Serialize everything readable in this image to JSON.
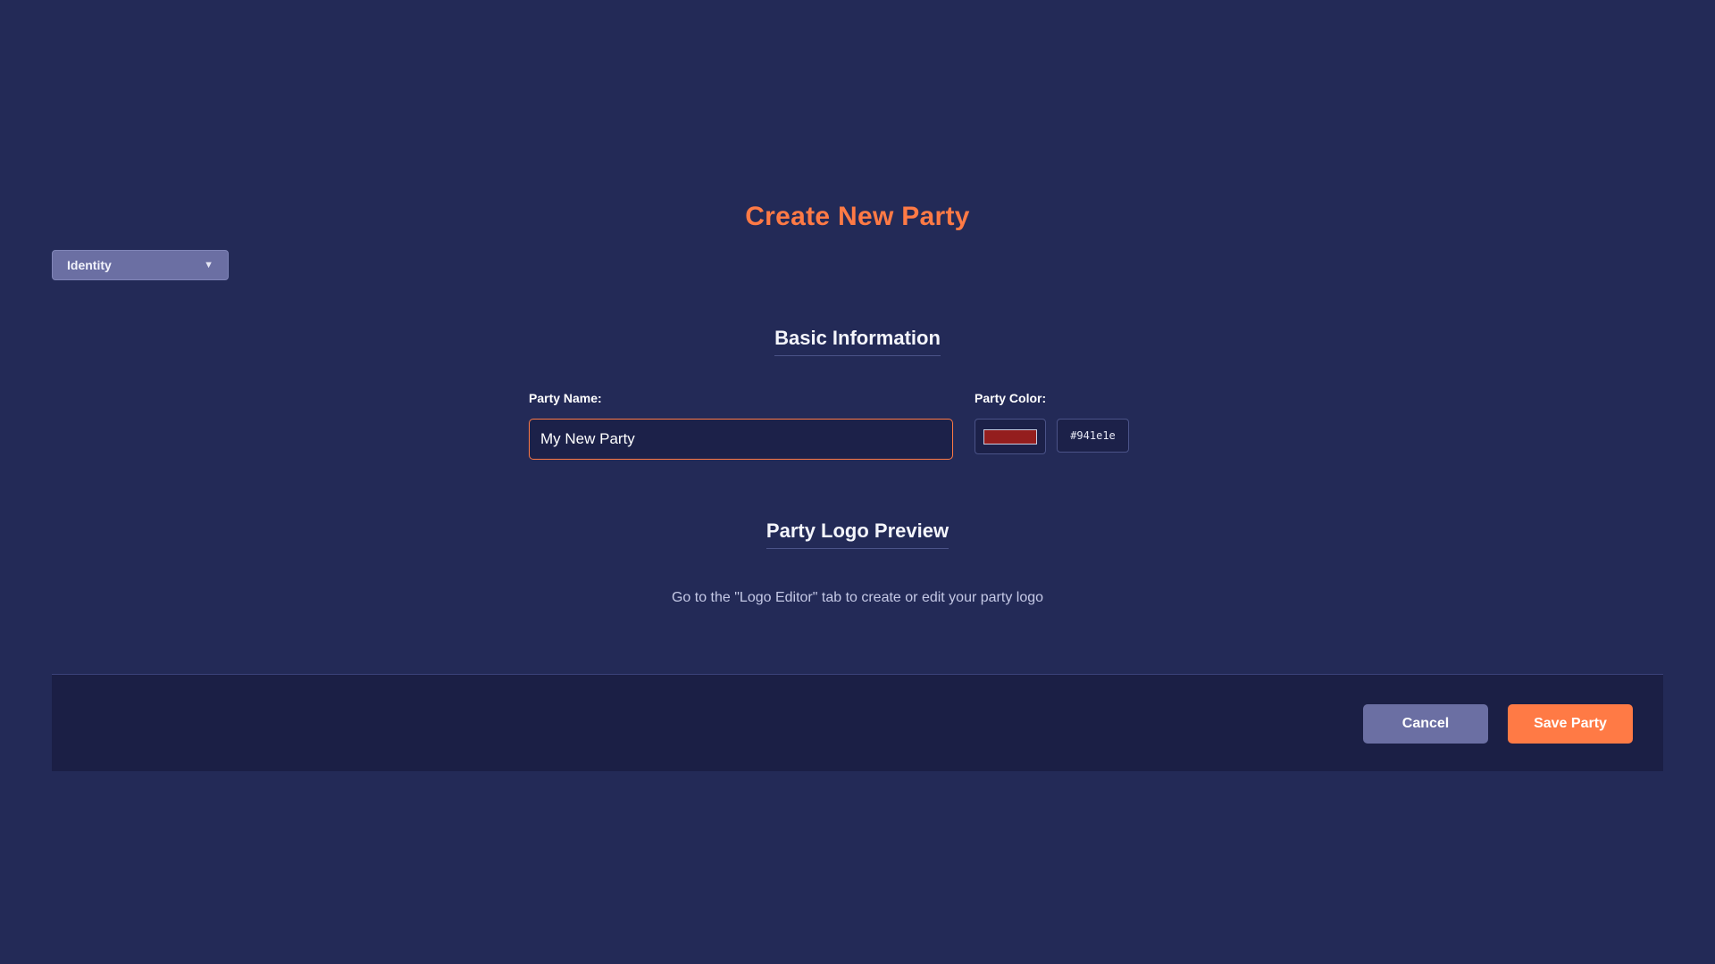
{
  "tab_select": {
    "selected": "Identity",
    "caret_icon": "chevron-down-icon"
  },
  "title": "Create New Party",
  "basic_info": {
    "heading": "Basic Information",
    "party_name_label": "Party Name:",
    "party_name_value": "My New Party",
    "party_color_label": "Party Color:",
    "party_color_value": "#941e1e",
    "party_color_hex_text": "#941e1e"
  },
  "logo_preview": {
    "heading": "Party Logo Preview",
    "hint": "Go to the \"Logo Editor\" tab to create or edit your party logo"
  },
  "footer": {
    "cancel_label": "Cancel",
    "save_label": "Save Party"
  },
  "colors": {
    "background": "#232a57",
    "accent": "#ff7a45",
    "secondary_button": "#6b6fa3",
    "footer_background": "#1b1f45"
  }
}
